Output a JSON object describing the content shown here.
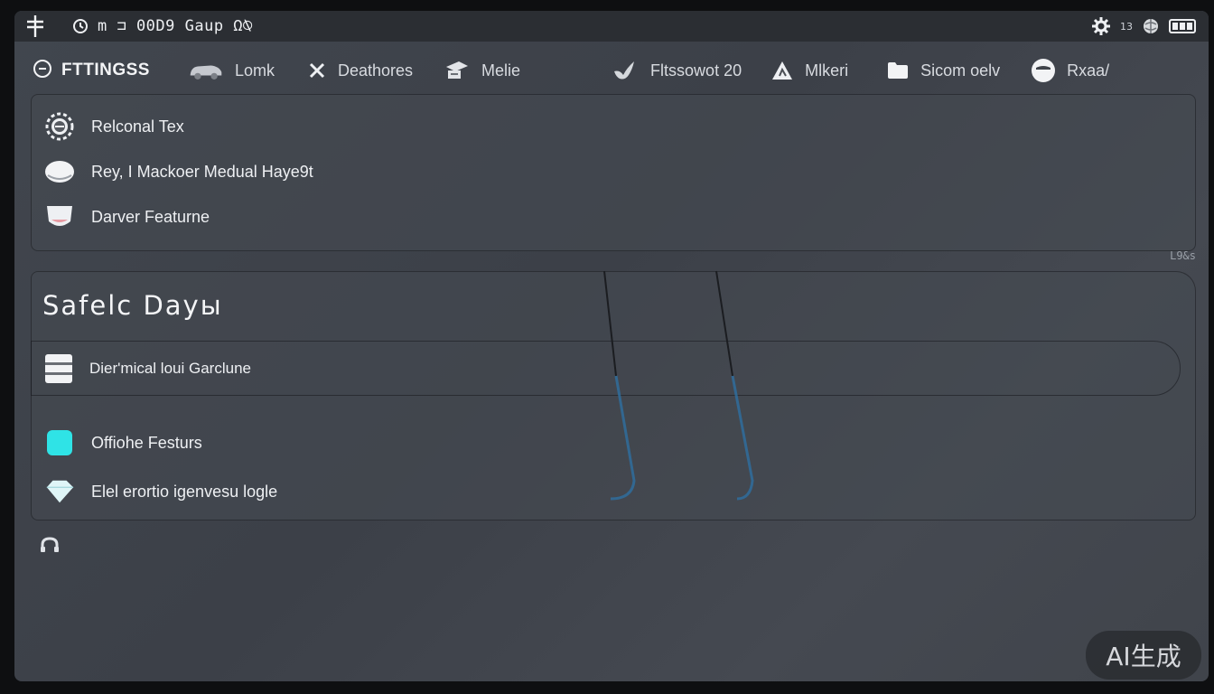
{
  "statusbar": {
    "left_text": "m ⊐ 00D9 Gaup Ω⍉",
    "right_small": "13"
  },
  "nav": {
    "brand": "FTTINGSS",
    "items": [
      {
        "label": "Lomk",
        "icon": "car-icon"
      },
      {
        "label": "Deathores",
        "icon": "close-icon"
      },
      {
        "label": "Melie",
        "icon": "graduation-cap-icon"
      },
      {
        "label": "Fltssowot 20",
        "icon": "bird-icon"
      },
      {
        "label": "Mlkeri",
        "icon": "triangle-icon"
      },
      {
        "label": "Sicom oelv",
        "icon": "folder-icon"
      },
      {
        "label": "Rxaa/",
        "icon": "user-icon"
      }
    ]
  },
  "card1": {
    "items": [
      {
        "label": "Relconal Tex",
        "icon": "gear-icon"
      },
      {
        "label": "Rey, I Mackoer Medual Haye9t",
        "icon": "cloud-icon"
      },
      {
        "label": "Darver Featurne",
        "icon": "cup-icon"
      }
    ]
  },
  "side_mark": "L9&s",
  "card2": {
    "title": "Safelc Dayы",
    "subrow": {
      "label": "Dier'mical loui Garclune",
      "icon": "server-icon"
    },
    "items": [
      {
        "label": "Offiohe Festurs",
        "icon": "square-icon",
        "color": "#2fe3e6"
      },
      {
        "label": "Elel erortio igenvesu logle",
        "icon": "diamond-icon"
      }
    ]
  },
  "watermark": "AI生成"
}
